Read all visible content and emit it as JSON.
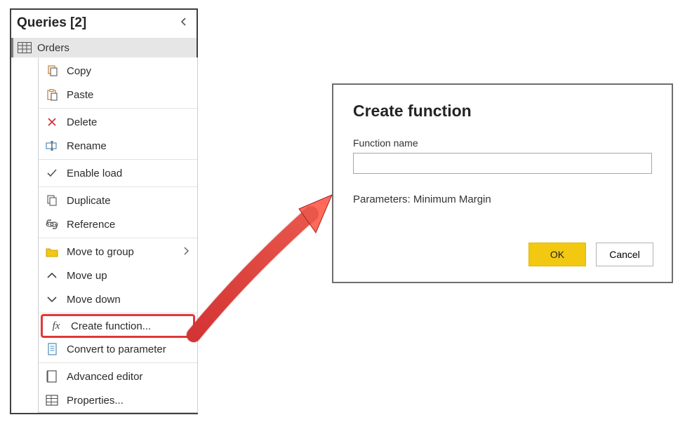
{
  "queries": {
    "header": "Queries [2]",
    "items": [
      {
        "label": "Orders"
      }
    ]
  },
  "context_menu": {
    "copy": "Copy",
    "paste": "Paste",
    "delete": "Delete",
    "rename": "Rename",
    "enable_load": "Enable load",
    "duplicate": "Duplicate",
    "reference": "Reference",
    "move_to_group": "Move to group",
    "move_up": "Move up",
    "move_down": "Move down",
    "create_function": "Create function...",
    "convert_to_parameter": "Convert to parameter",
    "advanced_editor": "Advanced editor",
    "properties": "Properties..."
  },
  "dialog": {
    "title": "Create function",
    "field_label": "Function name",
    "field_value": "",
    "parameters_text": "Parameters: Minimum Margin",
    "ok": "OK",
    "cancel": "Cancel"
  }
}
